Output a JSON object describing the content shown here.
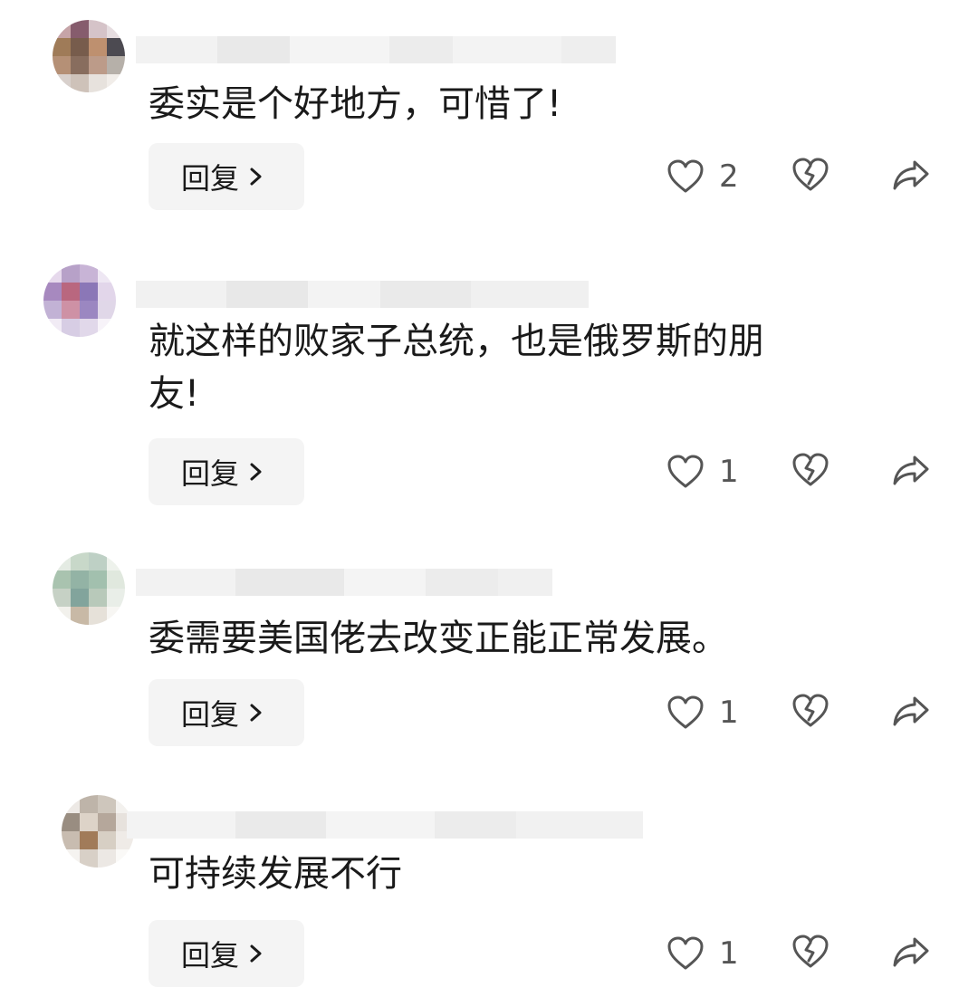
{
  "comments": [
    {
      "text": "委实是个好地方，可惜了!",
      "reply_label": "回复",
      "likes": "2",
      "avatar_colors": [
        "#c9a3a8",
        "#8a5b6e",
        "#d7c3c8",
        "#e7dde0",
        "#a37a54",
        "#7a5b4a",
        "#c28f6a",
        "#4c4a52",
        "#b98f72",
        "#8a6c5c",
        "#bf9a86",
        "#b7b0a8",
        "#d9d0cb",
        "#cfc2b8",
        "#e8e2dc",
        "#f1ede9"
      ]
    },
    {
      "text": "就这样的败家子总统，也是俄罗斯的朋\n友!",
      "reply_label": "回复",
      "likes": "1",
      "avatar_colors": [
        "#e7d9ee",
        "#b9a0cc",
        "#c9b3d9",
        "#efe7f4",
        "#a988c4",
        "#c06580",
        "#8c76bd",
        "#e3d6ec",
        "#c3b1d8",
        "#d38fa6",
        "#9c86c6",
        "#e1d7ea",
        "#f1ebf6",
        "#d8cde6",
        "#e2d8ec",
        "#f7f3f9"
      ]
    },
    {
      "text": "委需要美国佬去改变正能正常发展。",
      "reply_label": "回复",
      "likes": "1",
      "avatar_colors": [
        "#e4ebe2",
        "#c7d8c8",
        "#bdd1c4",
        "#eef2ec",
        "#a7c4ad",
        "#90b4a4",
        "#9fc1ad",
        "#dfe8dd",
        "#c5d1c4",
        "#7fa59c",
        "#b7cab9",
        "#e9eee7",
        "#f2f1ec",
        "#c9b9a4",
        "#e6e1d8",
        "#f7f6f3"
      ]
    },
    {
      "text": "可持续发展不行",
      "reply_label": "回复",
      "likes": "1",
      "avatar_colors": [
        "#ede9e4",
        "#bfb4a8",
        "#cfc6bb",
        "#f3f1ee",
        "#9a8d80",
        "#ded3c7",
        "#b6a799",
        "#e7e2dc",
        "#c9bcae",
        "#a57a55",
        "#d8cfc3",
        "#efebe6",
        "#f5f3f0",
        "#d9d0c6",
        "#ece8e3",
        "#faf9f7"
      ]
    }
  ]
}
